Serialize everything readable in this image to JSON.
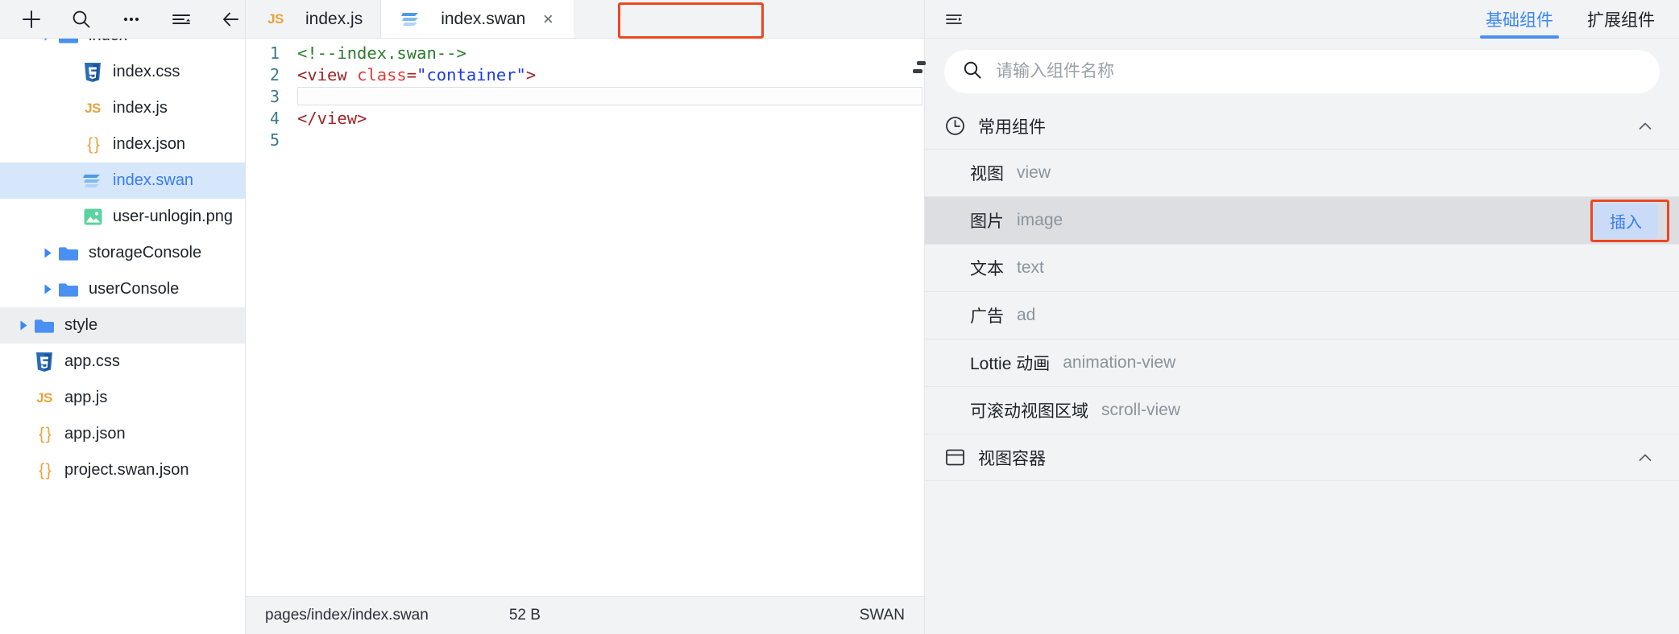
{
  "explorer": {
    "toolbar": [
      {
        "name": "new-file-button",
        "icon": "plus-icon"
      },
      {
        "name": "search-button",
        "icon": "search-icon"
      },
      {
        "name": "more-button",
        "icon": "ellipsis-icon"
      },
      {
        "name": "collapse-button",
        "icon": "collapse-list-icon"
      },
      {
        "name": "back-button",
        "icon": "arrow-left-icon"
      }
    ],
    "items": [
      {
        "label": "index",
        "icon": "folder-icon",
        "type": "folder",
        "indent": 1,
        "arrow": true,
        "state": "clipped"
      },
      {
        "label": "index.css",
        "icon": "css-icon",
        "type": "file",
        "indent": 2,
        "arrow": false,
        "state": "normal"
      },
      {
        "label": "index.js",
        "icon": "js-icon",
        "type": "file",
        "indent": 2,
        "arrow": false,
        "state": "normal"
      },
      {
        "label": "index.json",
        "icon": "json-icon",
        "type": "file",
        "indent": 2,
        "arrow": false,
        "state": "normal"
      },
      {
        "label": "index.swan",
        "icon": "swan-icon",
        "type": "file",
        "indent": 2,
        "arrow": false,
        "state": "selected"
      },
      {
        "label": "user-unlogin.png",
        "icon": "image-icon",
        "type": "file",
        "indent": 2,
        "arrow": false,
        "state": "normal"
      },
      {
        "label": "storageConsole",
        "icon": "folder-icon",
        "type": "folder",
        "indent": 1,
        "arrow": true,
        "state": "normal"
      },
      {
        "label": "userConsole",
        "icon": "folder-icon",
        "type": "folder",
        "indent": 1,
        "arrow": true,
        "state": "normal"
      },
      {
        "label": "style",
        "icon": "folder-icon",
        "type": "folder",
        "indent": 0,
        "arrow": true,
        "state": "hovered"
      },
      {
        "label": "app.css",
        "icon": "css-icon",
        "type": "file",
        "indent": 0,
        "arrow": false,
        "state": "normal"
      },
      {
        "label": "app.js",
        "icon": "js-icon",
        "type": "file",
        "indent": 0,
        "arrow": false,
        "state": "normal"
      },
      {
        "label": "app.json",
        "icon": "json-icon",
        "type": "file",
        "indent": 0,
        "arrow": false,
        "state": "normal"
      },
      {
        "label": "project.swan.json",
        "icon": "json-icon",
        "type": "file",
        "indent": 0,
        "arrow": false,
        "state": "clipped"
      }
    ]
  },
  "editor": {
    "tabs": [
      {
        "label": "index.js",
        "icon": "js-icon",
        "active": false,
        "closable": false
      },
      {
        "label": "index.swan",
        "icon": "swan-icon",
        "active": true,
        "closable": true,
        "close_label": "×",
        "highlighted": true
      }
    ],
    "code_lines": [
      {
        "num": "1",
        "tokens": [
          {
            "t": "<!--index.swan-->",
            "c": "comment"
          }
        ]
      },
      {
        "num": "2",
        "tokens": [
          {
            "t": "<view ",
            "c": "tag"
          },
          {
            "t": "class",
            "c": "attr"
          },
          {
            "t": "=",
            "c": "punct"
          },
          {
            "t": "\"container\"",
            "c": "str"
          },
          {
            "t": ">",
            "c": "tag"
          }
        ]
      },
      {
        "num": "3",
        "tokens": [
          {
            "t": "",
            "c": "plain"
          }
        ],
        "cursor": true
      },
      {
        "num": "4",
        "tokens": [
          {
            "t": "</view>",
            "c": "tag"
          }
        ]
      },
      {
        "num": "5",
        "tokens": [
          {
            "t": "",
            "c": "plain"
          }
        ]
      }
    ],
    "statusbar": {
      "path": "pages/index/index.swan",
      "size": "52 B",
      "language": "SWAN"
    }
  },
  "right_panel": {
    "menu_icon": "panel-toggle-icon",
    "tabs": [
      {
        "label": "基础组件",
        "active": true
      },
      {
        "label": "扩展组件",
        "active": false
      }
    ],
    "search": {
      "placeholder": "请输入组件名称",
      "value": "",
      "icon": "search-icon"
    },
    "groups": [
      {
        "title": "常用组件",
        "icon": "clock-icon",
        "expanded": true,
        "chevron": "chevron-up-icon",
        "items": [
          {
            "cn": "视图",
            "en": "view",
            "hovered": false,
            "insert_label": ""
          },
          {
            "cn": "图片",
            "en": "image",
            "hovered": true,
            "insert_label": "插入",
            "highlighted": true
          },
          {
            "cn": "文本",
            "en": "text",
            "hovered": false,
            "insert_label": ""
          },
          {
            "cn": "广告",
            "en": "ad",
            "hovered": false,
            "insert_label": ""
          },
          {
            "cn": "Lottie 动画",
            "en": "animation-view",
            "hovered": false,
            "insert_label": ""
          },
          {
            "cn": "可滚动视图区域",
            "en": "scroll-view",
            "hovered": false,
            "insert_label": ""
          }
        ]
      },
      {
        "title": "视图容器",
        "icon": "container-icon",
        "expanded": true,
        "chevron": "chevron-up-icon",
        "items": []
      }
    ]
  },
  "colors": {
    "accent_blue": "#3a86f5",
    "selection_blue": "#d6e6fb",
    "annotation_red": "#ee4622",
    "toolbar_grey": "#f1f3f5",
    "hover_grey": "#dcdee2"
  }
}
